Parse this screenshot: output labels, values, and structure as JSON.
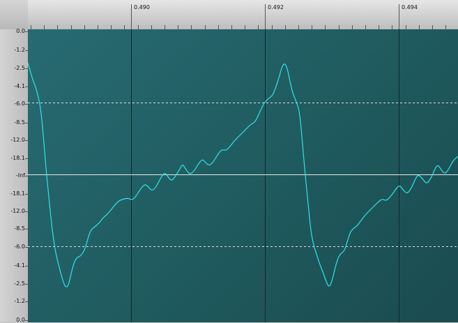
{
  "ruler": {
    "time_labels": [
      "0.490",
      "0.492",
      "0.494"
    ]
  },
  "scale": {
    "db_labels": [
      "0.0",
      "-1.2",
      "-2.5",
      "-4.1",
      "-6.0",
      "-8.5",
      "-12.0",
      "-18.1",
      "-Inf",
      "-18.1",
      "-12.0",
      "-8.5",
      "-6.0",
      "-4.1",
      "-2.5",
      "-1.2",
      "0.0"
    ]
  },
  "colors": {
    "waveform": "#2fe6e6",
    "background": "#1f5a5e",
    "center_line": "#e8e8e8",
    "guide_line": "#e0e0e0"
  },
  "waveform": {
    "period_ms": 0.00375,
    "start_time": 0.4877
  }
}
